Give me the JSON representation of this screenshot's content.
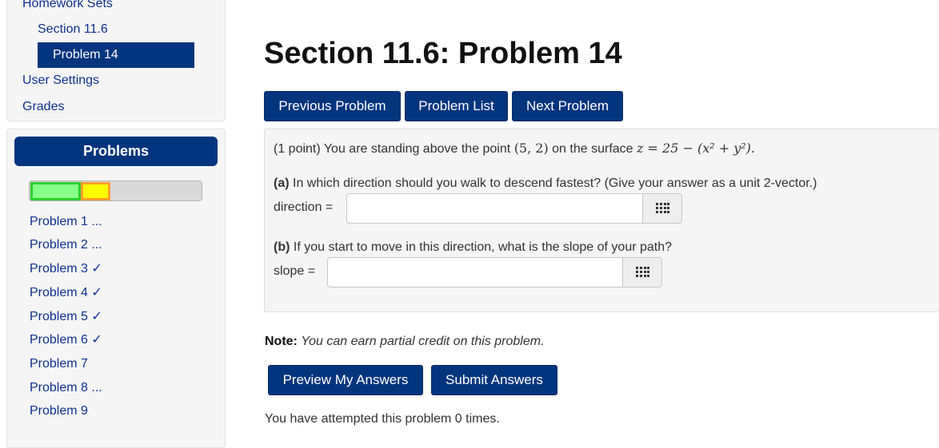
{
  "nav": {
    "homework_sets": "Homework Sets",
    "section": "Section 11.6",
    "current_problem": "Problem 14",
    "user_settings": "User Settings",
    "grades": "Grades"
  },
  "problems_panel": {
    "title": "Problems",
    "progress": {
      "correct_fraction": 0.29,
      "partial_fraction": 0.17,
      "correct_color": "#88ff88",
      "partial_color": "#ffff00"
    },
    "items": [
      "Problem 1 ...",
      "Problem 2 ...",
      "Problem 3 ✓",
      "Problem 4 ✓",
      "Problem 5 ✓",
      "Problem 6 ✓",
      "Problem 7",
      "Problem 8 ...",
      "Problem 9"
    ]
  },
  "page": {
    "title": "Section 11.6: Problem 14"
  },
  "nav_buttons": {
    "previous": "Previous Problem",
    "list": "Problem List",
    "next": "Next Problem"
  },
  "problem": {
    "intro_prefix": "(1 point) You are standing above the point",
    "point": "(5, 2)",
    "intro_mid": "on the surface",
    "surface": "z = 25 − (x² + y²).",
    "part_a_label": "(a)",
    "part_a_text": "In which direction should you walk to descend fastest? (Give your answer as a unit 2-vector.)",
    "direction_label": "direction =",
    "direction_value": "",
    "part_b_label": "(b)",
    "part_b_text": "If you start to move in this direction, what is the slope of your path?",
    "slope_label": "slope =",
    "slope_value": ""
  },
  "note": {
    "label": "Note:",
    "text": "You can earn partial credit on this problem."
  },
  "submit": {
    "preview": "Preview My Answers",
    "submit": "Submit Answers"
  },
  "attempts": "You have attempted this problem 0 times.",
  "colors": {
    "primary": "#03357e",
    "link": "#0e3191",
    "panel_bg": "#f5f5f5"
  }
}
